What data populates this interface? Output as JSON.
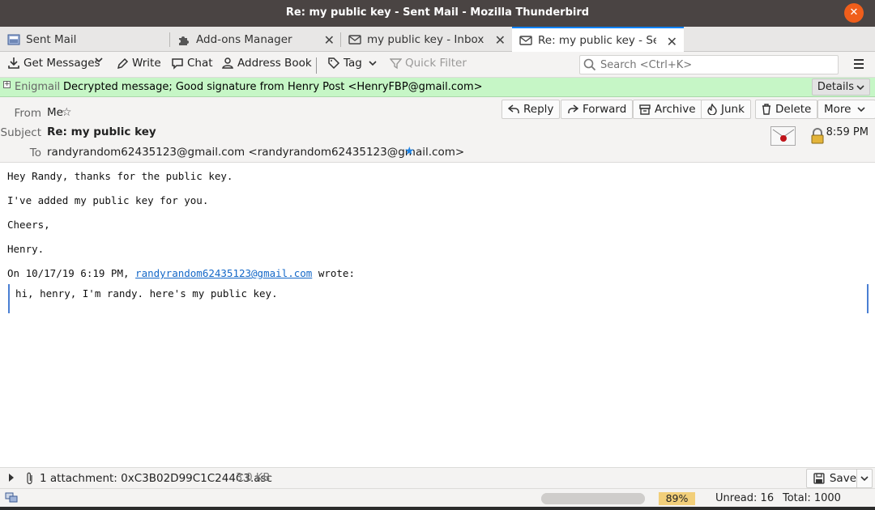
{
  "window": {
    "title": "Re: my public key - Sent Mail - Mozilla Thunderbird"
  },
  "tabs": [
    {
      "label": "Sent Mail",
      "icon": "folder-icon"
    },
    {
      "label": "Add-ons Manager",
      "icon": "puzzle-icon"
    },
    {
      "label": "my public key - Inbox",
      "icon": "envelope-icon"
    },
    {
      "label": "Re: my public key - Sent",
      "icon": "envelope-icon",
      "active": true
    }
  ],
  "toolbar": {
    "get_messages": "Get Messages",
    "write": "Write",
    "chat": "Chat",
    "address_book": "Address Book",
    "tag": "Tag",
    "quick_filter": "Quick Filter",
    "search_placeholder": "Search <Ctrl+K>"
  },
  "enigmail": {
    "label": "Enigmail",
    "message": "Decrypted message; Good signature from Henry Post <HenryFBP@gmail.com>",
    "details": "Details"
  },
  "header": {
    "from_label": "From",
    "from": "Me",
    "subject_label": "Subject",
    "subject": "Re: my public key",
    "to_label": "To",
    "to": "randyrandom62435123@gmail.com <randyrandom62435123@gmail.com>",
    "time": "8:59 PM",
    "buttons": {
      "reply": "Reply",
      "forward": "Forward",
      "archive": "Archive",
      "junk": "Junk",
      "delete": "Delete",
      "more": "More"
    }
  },
  "body": {
    "lines": [
      "Hey Randy, thanks for the public key.",
      "I've added my public key for you.",
      "Cheers,",
      "Henry."
    ],
    "quote_prefix": "On 10/17/19 6:19 PM, ",
    "quote_link": "randyrandom62435123@gmail.com",
    "quote_suffix": " wrote:",
    "quoted_text": "hi, henry, I'm randy. here's my public key."
  },
  "attachments": {
    "text": "1 attachment: 0xC3B02D99C1C244C3.asc",
    "size": "3.0 KB",
    "save": "Save"
  },
  "status": {
    "quota_percent": "89%",
    "unread": "Unread: 16",
    "total": "Total: 1000"
  },
  "colors": {
    "accent": "#0a84ff",
    "enigmail_bg": "#c6f6c6",
    "quota_bg": "#f2cf7a",
    "titlebar_bg": "#4a4443",
    "close_button": "#f05e1b"
  }
}
